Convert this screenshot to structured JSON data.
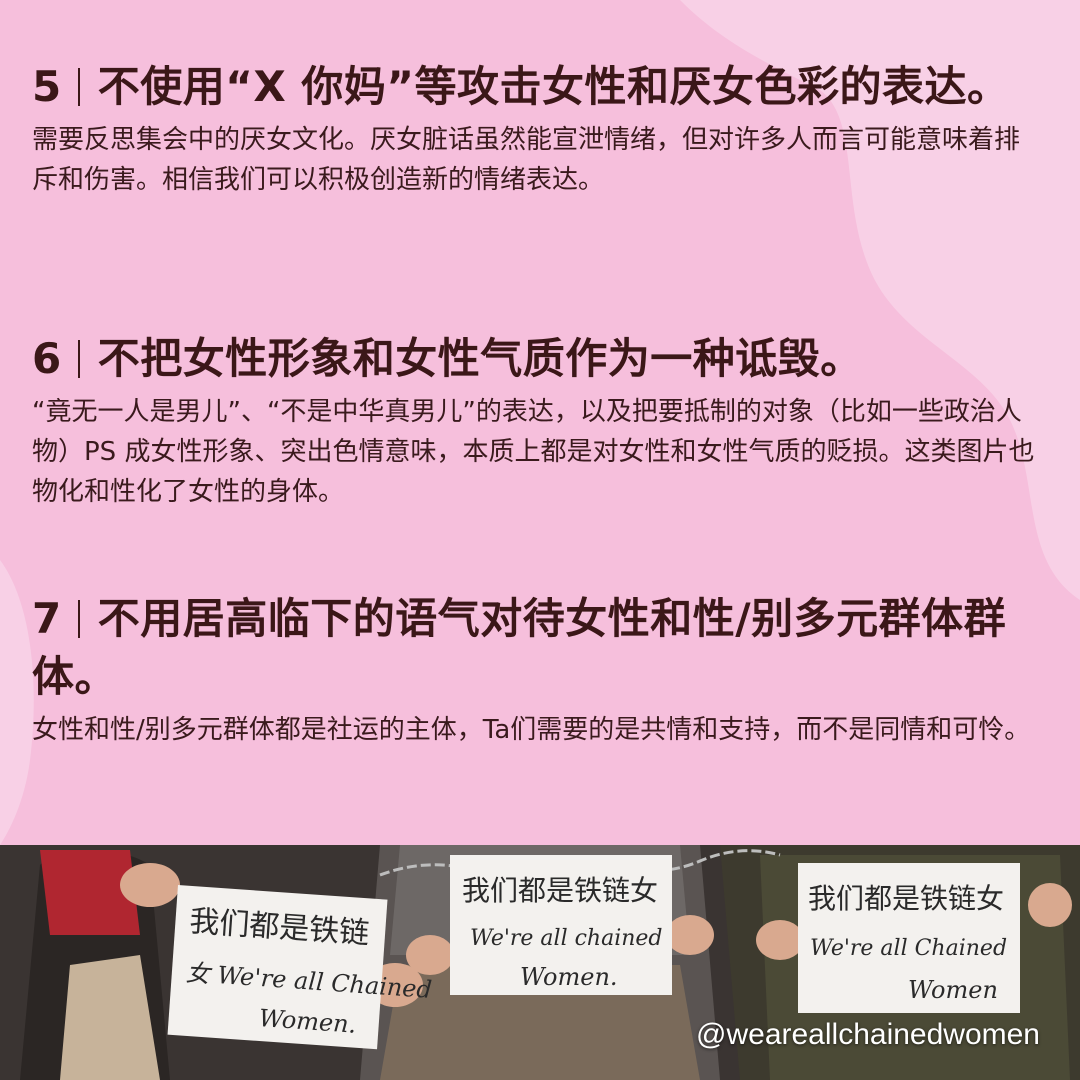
{
  "sections": [
    {
      "number": "5",
      "heading": "不使用“X 你妈”等攻击女性和厌女色彩的表达。",
      "body": "需要反思集会中的厌女文化。厌女脏话虽然能宣泄情绪，但对许多人而言可能意味着排斥和伤害。相信我们可以积极创造新的情绪表达。"
    },
    {
      "number": "6",
      "heading": "不把女性形象和女性气质作为一种诋毁。",
      "body": "“竟无一人是男儿”、“不是中华真男儿”的表达，以及把要抵制的对象（比如一些政治人物）PS 成女性形象、突出色情意味，本质上都是对女性和女性气质的贬损。这类图片也物化和性化了女性的身体。"
    },
    {
      "number": "7",
      "heading": "不用居高临下的语气对待女性和性/别多元群体群体。",
      "body": "女性和性/别多元群体都是社运的主体，Ta们需要的是共情和支持，而不是同情和可怜。"
    }
  ],
  "photo": {
    "signs": [
      {
        "line1": "我们都是铁链",
        "line2": "女 We're all Chained",
        "line3": "Women."
      },
      {
        "line1": "我们都是铁链女",
        "line2": "We're all chained",
        "line3": "Women."
      },
      {
        "line1": "我们都是铁链女",
        "line2": "We're all Chained",
        "line3": "Women"
      }
    ],
    "handle": "@weareallchainedwomen"
  },
  "colors": {
    "background": "#f6bfdc",
    "blob_light": "#f8d0e6",
    "heading": "#3b1718",
    "body_text": "#3a1a1d"
  }
}
